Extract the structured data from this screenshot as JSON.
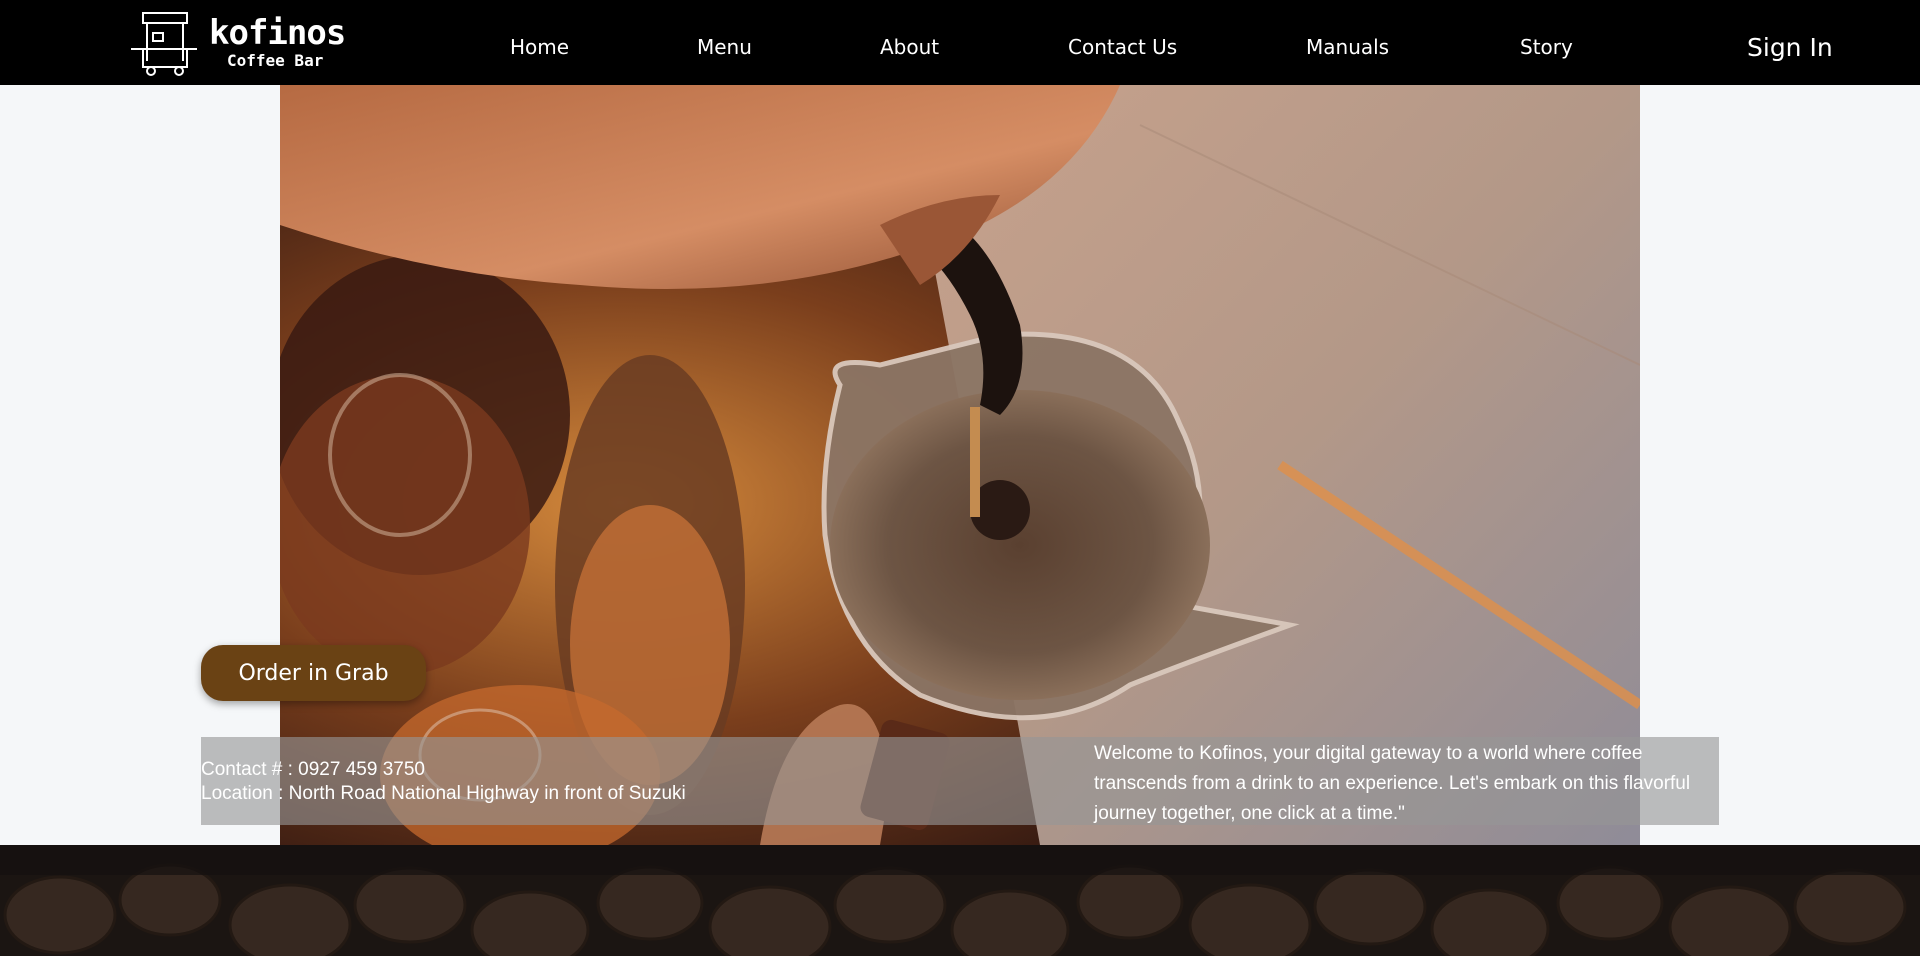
{
  "brand": {
    "name": "kofinos",
    "subtitle": "Coffee Bar",
    "cart_badge": "kofinos Coffee Bar"
  },
  "nav": {
    "items": [
      {
        "label": "Home"
      },
      {
        "label": "Menu"
      },
      {
        "label": "About"
      },
      {
        "label": "Contact Us"
      },
      {
        "label": "Manuals"
      },
      {
        "label": "Story"
      }
    ],
    "sign_in": "Sign In"
  },
  "hero": {
    "order_button": "Order in Grab",
    "contact": "Contact # : 0927 459 3750",
    "location": "Location : North Road National Highway in front of Suzuki",
    "welcome": "Welcome to Kofinos, your digital gateway to a world where coffee transcends from a drink to an experience. Let's embark on this flavorful journey together, one click at a time.\""
  },
  "icons": {
    "logo": "coffee-cart-icon"
  },
  "colors": {
    "nav_background": "#000000",
    "order_button": "#6a4214",
    "page_background": "#f5f7f9",
    "footer_background": "#1b1512"
  }
}
